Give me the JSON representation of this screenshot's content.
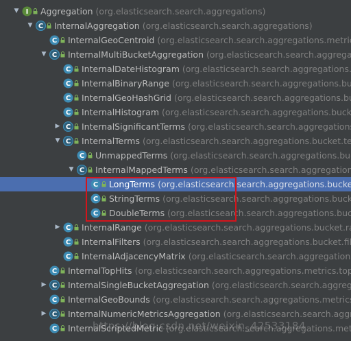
{
  "colors": {
    "background": "#3c3f41",
    "selection": "#4b6eaf",
    "class_icon": "#3d8bb3",
    "highlight_border": "#d6141b"
  },
  "tree": {
    "nodes": [
      {
        "name": "Aggregation",
        "package": "(org.elasticsearch.search.aggregations)",
        "expander": "expanded",
        "icon": "interface-icon"
      },
      {
        "name": "InternalAggregation",
        "package": "(org.elasticsearch.search.aggregations)",
        "expander": "expanded",
        "icon": "abstract-class-icon"
      },
      {
        "name": "InternalGeoCentroid",
        "package": "(org.elasticsearch.search.aggregations.metrics.c",
        "expander": "none",
        "icon": "class-icon"
      },
      {
        "name": "InternalMultiBucketAggregation",
        "package": "(org.elasticsearch.search.aggregati",
        "expander": "expanded",
        "icon": "abstract-class-icon"
      },
      {
        "name": "InternalDateHistogram",
        "package": "(org.elasticsearch.search.aggregations.bu",
        "expander": "none",
        "icon": "class-icon"
      },
      {
        "name": "InternalBinaryRange",
        "package": "(org.elasticsearch.search.aggregations.bucket",
        "expander": "none",
        "icon": "class-icon"
      },
      {
        "name": "InternalGeoHashGrid",
        "package": "(org.elasticsearch.search.aggregations.buc",
        "expander": "none",
        "icon": "class-icon"
      },
      {
        "name": "InternalHistogram",
        "package": "(org.elasticsearch.search.aggregations.bucket",
        "expander": "none",
        "icon": "class-icon"
      },
      {
        "name": "InternalSignificantTerms",
        "package": "(org.elasticsearch.search.aggregations.b",
        "expander": "collapsed",
        "icon": "abstract-class-icon"
      },
      {
        "name": "InternalTerms",
        "package": "(org.elasticsearch.search.aggregations.bucket.term",
        "expander": "expanded",
        "icon": "abstract-class-icon"
      },
      {
        "name": "UnmappedTerms",
        "package": "(org.elasticsearch.search.aggregations.buck",
        "expander": "none",
        "icon": "class-icon"
      },
      {
        "name": "InternalMappedTerms",
        "package": "(org.elasticsearch.search.aggregations.buc",
        "expander": "expanded",
        "icon": "abstract-class-icon"
      },
      {
        "name": "LongTerms",
        "package": "(org.elasticsearch.search.aggregations.bucket",
        "expander": "none",
        "icon": "class-icon",
        "selected": true
      },
      {
        "name": "StringTerms",
        "package": "(org.elasticsearch.search.aggregations.bucke",
        "expander": "none",
        "icon": "class-icon"
      },
      {
        "name": "DoubleTerms",
        "package": "(org.elasticsearch.search.aggregations.bucke",
        "expander": "none",
        "icon": "class-icon"
      },
      {
        "name": "InternalRange",
        "package": "(org.elasticsearch.search.aggregations.bucket.rang",
        "expander": "collapsed",
        "icon": "class-icon"
      },
      {
        "name": "InternalFilters",
        "package": "(org.elasticsearch.search.aggregations.bucket.filter",
        "expander": "none",
        "icon": "class-icon"
      },
      {
        "name": "InternalAdjacencyMatrix",
        "package": "(org.elasticsearch.search.aggregations.b",
        "expander": "none",
        "icon": "class-icon"
      },
      {
        "name": "InternalTopHits",
        "package": "(org.elasticsearch.search.aggregations.metrics.tophi",
        "expander": "none",
        "icon": "class-icon"
      },
      {
        "name": "InternalSingleBucketAggregation",
        "package": "(org.elasticsearch.search.aggregat",
        "expander": "collapsed",
        "icon": "abstract-class-icon"
      },
      {
        "name": "InternalGeoBounds",
        "package": "(org.elasticsearch.search.aggregations.metrics.ge",
        "expander": "none",
        "icon": "class-icon"
      },
      {
        "name": "InternalNumericMetricsAggregation",
        "package": "(org.elasticsearch.search.aggrega",
        "expander": "collapsed",
        "icon": "abstract-class-icon"
      },
      {
        "name": "InternalScriptedMetric",
        "package": "(org.elasticsearch.search.aggregations.metri",
        "expander": "none",
        "icon": "class-icon"
      }
    ]
  },
  "watermark": "https://blog.csdn.net/weixin_42533184"
}
